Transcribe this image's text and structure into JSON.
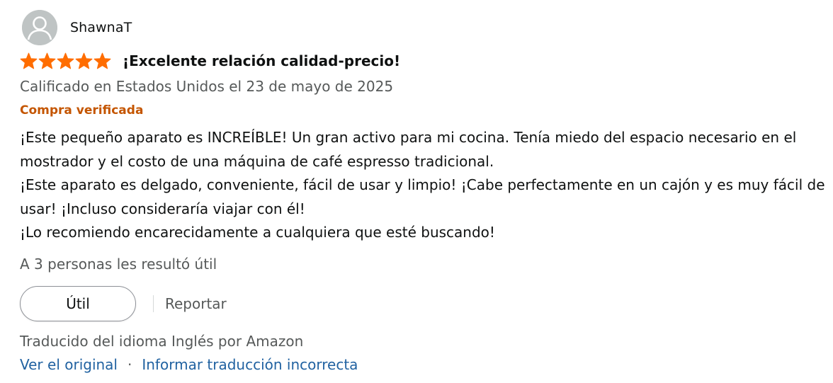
{
  "reviewer": {
    "name": "ShawnaT",
    "avatar_icon": "user-silhouette-icon"
  },
  "rating": {
    "stars": 5,
    "max": 5,
    "color": "#ff6d00"
  },
  "review": {
    "title": "¡Excelente relación calidad-precio!",
    "date": "Calificado en Estados Unidos el 23 de mayo de 2025",
    "verified": "Compra verificada",
    "body": [
      "¡Este pequeño aparato es INCREÍBLE! Un gran activo para mi cocina. Tenía miedo del espacio necesario en el mostrador y el costo de una máquina de café espresso tradicional.",
      "¡Este aparato es delgado, conveniente, fácil de usar y limpio! ¡Cabe perfectamente en un cajón y es muy fácil de usar! ¡Incluso consideraría viajar con él!",
      "¡Lo recomiendo encarecidamente a cualquiera que esté buscando!"
    ],
    "helpful_count": "A 3 personas les resultó útil"
  },
  "actions": {
    "helpful_label": "Útil",
    "report_label": "Reportar"
  },
  "translation": {
    "note": "Traducido del idioma Inglés por Amazon",
    "see_original": "Ver el original",
    "separator": "·",
    "report_translation": "Informar traducción incorrecta"
  },
  "colors": {
    "verified": "#c45500",
    "link": "#2162a1",
    "secondary_text": "#565959"
  }
}
